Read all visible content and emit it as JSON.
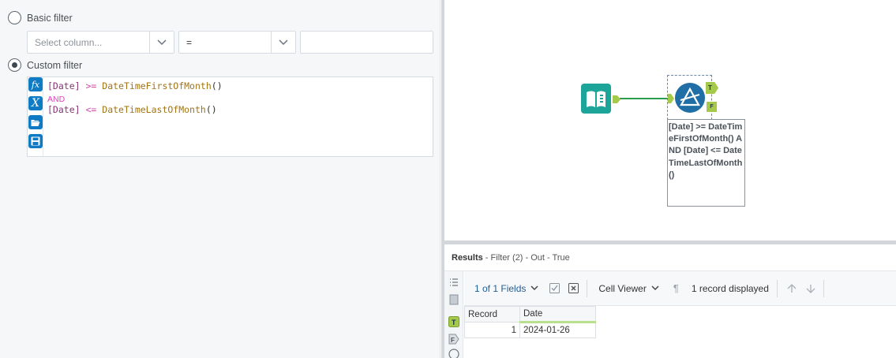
{
  "config": {
    "basic_filter_label": "Basic filter",
    "column_placeholder": "Select column...",
    "operator_value": "=",
    "value_field": "",
    "custom_filter_label": "Custom filter",
    "expression": {
      "line1_field": "[Date]",
      "line1_op": ">=",
      "line1_fn": "DateTimeFirstOfMonth",
      "line1_paren": "()",
      "line2_kw": "AND",
      "line3_field": "[Date]",
      "line3_op": "<=",
      "line3_fn": "DateTimeLastOfMonth",
      "line3_paren": "()"
    },
    "editor_buttons": [
      "function-icon",
      "variable-icon",
      "open-icon",
      "save-icon"
    ]
  },
  "canvas": {
    "filter_true_anchor": "T",
    "filter_false_anchor": "F",
    "annotation": "[Date] >= DateTimeFirstOfMonth() AND [Date] <= DateTimeLastOfMonth()"
  },
  "results": {
    "title_bold": "Results",
    "title_rest": " - Filter (2) - Out - True",
    "fields_label": "1 of 1 Fields",
    "viewer_label": "Cell Viewer",
    "records_label": "1 record displayed",
    "columns": [
      "Record",
      "Date"
    ],
    "rows": [
      [
        "1",
        "2024-01-26"
      ]
    ]
  },
  "colors": {
    "accent": "#0f7bc5",
    "input_tool": "#1ea59a",
    "filter_tool": "#1f6fa6",
    "anchor": "#a4c94b"
  }
}
